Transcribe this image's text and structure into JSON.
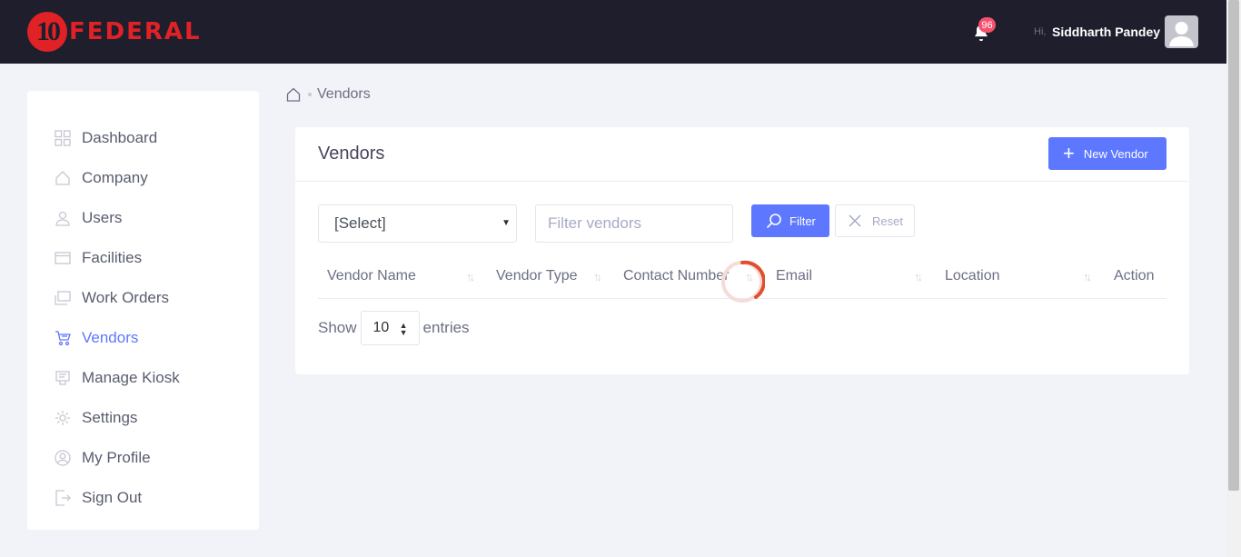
{
  "header": {
    "logo_number": "10",
    "logo_text": "FEDERAL",
    "notification_count": "96",
    "greeting": "Hi,",
    "user_name": "Siddharth Pandey"
  },
  "sidebar": {
    "items": [
      {
        "label": "Dashboard",
        "icon": "dashboard-icon",
        "active": false
      },
      {
        "label": "Company",
        "icon": "home-icon",
        "active": false
      },
      {
        "label": "Users",
        "icon": "users-icon",
        "active": false
      },
      {
        "label": "Facilities",
        "icon": "facilities-icon",
        "active": false
      },
      {
        "label": "Work Orders",
        "icon": "work-orders-icon",
        "active": false
      },
      {
        "label": "Vendors",
        "icon": "cart-icon",
        "active": true
      },
      {
        "label": "Manage Kiosk",
        "icon": "kiosk-icon",
        "active": false
      },
      {
        "label": "Settings",
        "icon": "gear-icon",
        "active": false
      },
      {
        "label": "My Profile",
        "icon": "profile-icon",
        "active": false
      },
      {
        "label": "Sign Out",
        "icon": "sign-out-icon",
        "active": false
      }
    ]
  },
  "breadcrumb": {
    "current": "Vendors"
  },
  "card": {
    "title": "Vendors",
    "new_button": "New Vendor",
    "select_value": "[Select]",
    "filter_placeholder": "Filter vendors",
    "filter_button": "Filter",
    "reset_button": "Reset",
    "columns": [
      "Vendor Name",
      "Vendor Type",
      "Contact Number",
      "Email",
      "Location",
      "Action"
    ],
    "show_label": "Show",
    "page_length": "10",
    "entries_label": "entries"
  },
  "colors": {
    "accent": "#5d78ff",
    "header_bg": "#1e1e2d",
    "brand_red": "#e02226",
    "badge": "#f4516c"
  }
}
